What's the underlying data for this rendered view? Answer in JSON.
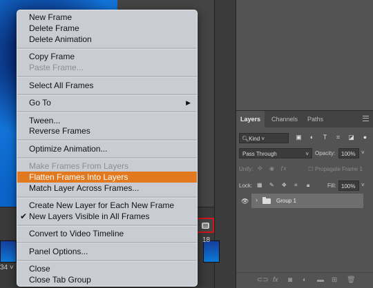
{
  "timeline": {
    "frame_number": "18",
    "loop_label": "34 ˅"
  },
  "context_menu": {
    "items": [
      {
        "label": "New Frame",
        "disabled": false
      },
      {
        "label": "Delete Frame",
        "disabled": false
      },
      {
        "label": "Delete Animation",
        "disabled": false
      },
      {
        "label": "Copy Frame",
        "disabled": false
      },
      {
        "label": "Paste Frame...",
        "disabled": true
      },
      {
        "label": "Select All Frames",
        "disabled": false
      },
      {
        "label": "Go To",
        "disabled": false,
        "submenu": true
      },
      {
        "label": "Tween...",
        "disabled": false
      },
      {
        "label": "Reverse Frames",
        "disabled": false
      },
      {
        "label": "Optimize Animation...",
        "disabled": false
      },
      {
        "label": "Make Frames From Layers",
        "disabled": true
      },
      {
        "label": "Flatten Frames Into Layers",
        "disabled": false,
        "highlighted": true
      },
      {
        "label": "Match Layer Across Frames...",
        "disabled": false
      },
      {
        "label": "Create New Layer for Each New Frame",
        "disabled": false
      },
      {
        "label": "New Layers Visible in All Frames",
        "disabled": false,
        "checked": true
      },
      {
        "label": "Convert to Video Timeline",
        "disabled": false
      },
      {
        "label": "Panel Options...",
        "disabled": false
      },
      {
        "label": "Close",
        "disabled": false
      },
      {
        "label": "Close Tab Group",
        "disabled": false
      }
    ]
  },
  "layers_panel": {
    "tabs": [
      "Layers",
      "Channels",
      "Paths"
    ],
    "active_tab": "Layers",
    "filter_kind": "Kind",
    "blend_mode": "Pass Through",
    "opacity_label": "Opacity:",
    "opacity_value": "100%",
    "unify_label": "Unify:",
    "propagate_label": "Propagate Frame 1",
    "lock_label": "Lock:",
    "fill_label": "Fill:",
    "fill_value": "100%",
    "layers": [
      {
        "name": "Group 1",
        "visible": true,
        "type": "group"
      }
    ]
  },
  "colors": {
    "highlight": "#e2791f",
    "annotation_box": "#d3141b"
  }
}
